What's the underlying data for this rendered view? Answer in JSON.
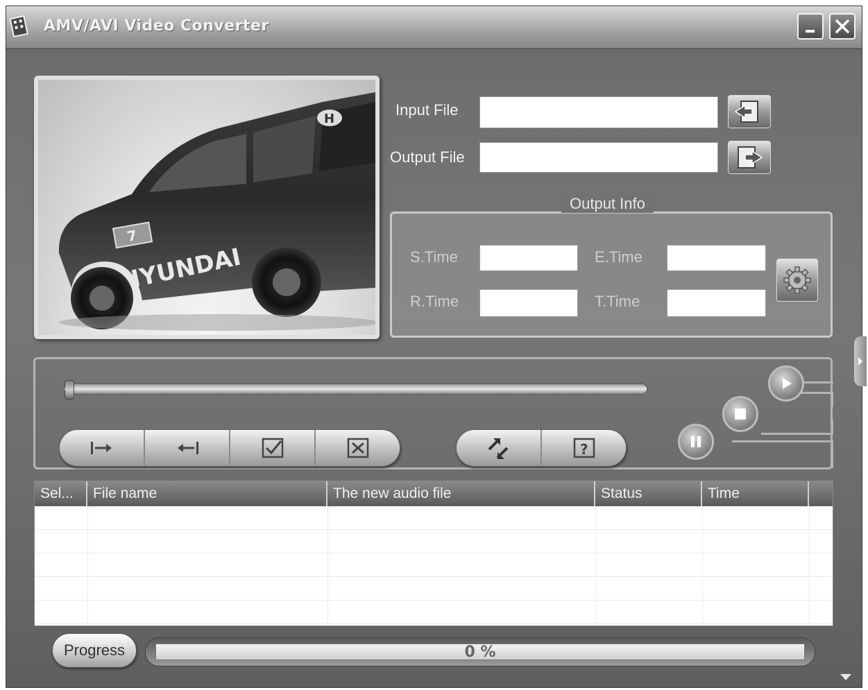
{
  "window": {
    "title": "AMV/AVI Video Converter"
  },
  "preview": {
    "car_badge_text": "HYUNDAI",
    "car_number": "7"
  },
  "files": {
    "input_label": "Input File",
    "input_value": "",
    "output_label": "Output File",
    "output_value": ""
  },
  "output_info": {
    "title": "Output Info",
    "s_time_label": "S.Time",
    "s_time_value": "",
    "e_time_label": "E.Time",
    "e_time_value": "",
    "r_time_label": "R.Time",
    "r_time_value": "",
    "t_time_label": "T.Time",
    "t_time_value": ""
  },
  "player": {
    "seek_fraction": 0.0,
    "edit_buttons": [
      "set-start",
      "set-end",
      "check",
      "delete"
    ],
    "tool_buttons": [
      "convert",
      "help"
    ],
    "help_glyph": "?"
  },
  "table": {
    "columns": [
      "Sel...",
      "File name",
      "The new audio file",
      "Status",
      "Time"
    ],
    "rows": []
  },
  "progress": {
    "button_label": "Progress",
    "percent": 0,
    "text": "0 %"
  },
  "icons": {
    "app": "film-icon",
    "minimize": "minimize-icon",
    "close": "close-icon",
    "input_browse": "open-folder-icon",
    "output_browse": "save-folder-icon",
    "settings": "gear-icon",
    "play": "play-icon",
    "stop": "stop-icon",
    "pause": "pause-icon"
  },
  "colors": {
    "titlebar": "#a8a8a8",
    "panel": "#6e6e6e",
    "text_light": "#f2f2f2"
  }
}
